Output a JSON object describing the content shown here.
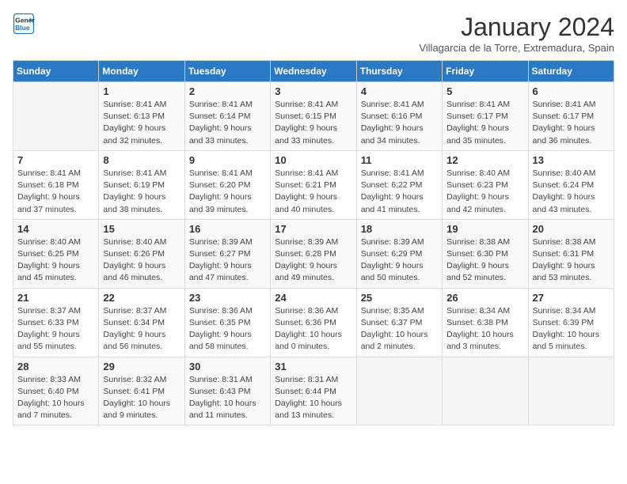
{
  "logo": {
    "line1": "General",
    "line2": "Blue"
  },
  "title": "January 2024",
  "subtitle": "Villagarcia de la Torre, Extremadura, Spain",
  "days_header": [
    "Sunday",
    "Monday",
    "Tuesday",
    "Wednesday",
    "Thursday",
    "Friday",
    "Saturday"
  ],
  "weeks": [
    [
      {
        "day": "",
        "content": ""
      },
      {
        "day": "1",
        "content": "Sunrise: 8:41 AM\nSunset: 6:13 PM\nDaylight: 9 hours\nand 32 minutes."
      },
      {
        "day": "2",
        "content": "Sunrise: 8:41 AM\nSunset: 6:14 PM\nDaylight: 9 hours\nand 33 minutes."
      },
      {
        "day": "3",
        "content": "Sunrise: 8:41 AM\nSunset: 6:15 PM\nDaylight: 9 hours\nand 33 minutes."
      },
      {
        "day": "4",
        "content": "Sunrise: 8:41 AM\nSunset: 6:16 PM\nDaylight: 9 hours\nand 34 minutes."
      },
      {
        "day": "5",
        "content": "Sunrise: 8:41 AM\nSunset: 6:17 PM\nDaylight: 9 hours\nand 35 minutes."
      },
      {
        "day": "6",
        "content": "Sunrise: 8:41 AM\nSunset: 6:17 PM\nDaylight: 9 hours\nand 36 minutes."
      }
    ],
    [
      {
        "day": "7",
        "content": "Sunrise: 8:41 AM\nSunset: 6:18 PM\nDaylight: 9 hours\nand 37 minutes."
      },
      {
        "day": "8",
        "content": "Sunrise: 8:41 AM\nSunset: 6:19 PM\nDaylight: 9 hours\nand 38 minutes."
      },
      {
        "day": "9",
        "content": "Sunrise: 8:41 AM\nSunset: 6:20 PM\nDaylight: 9 hours\nand 39 minutes."
      },
      {
        "day": "10",
        "content": "Sunrise: 8:41 AM\nSunset: 6:21 PM\nDaylight: 9 hours\nand 40 minutes."
      },
      {
        "day": "11",
        "content": "Sunrise: 8:41 AM\nSunset: 6:22 PM\nDaylight: 9 hours\nand 41 minutes."
      },
      {
        "day": "12",
        "content": "Sunrise: 8:40 AM\nSunset: 6:23 PM\nDaylight: 9 hours\nand 42 minutes."
      },
      {
        "day": "13",
        "content": "Sunrise: 8:40 AM\nSunset: 6:24 PM\nDaylight: 9 hours\nand 43 minutes."
      }
    ],
    [
      {
        "day": "14",
        "content": "Sunrise: 8:40 AM\nSunset: 6:25 PM\nDaylight: 9 hours\nand 45 minutes."
      },
      {
        "day": "15",
        "content": "Sunrise: 8:40 AM\nSunset: 6:26 PM\nDaylight: 9 hours\nand 46 minutes."
      },
      {
        "day": "16",
        "content": "Sunrise: 8:39 AM\nSunset: 6:27 PM\nDaylight: 9 hours\nand 47 minutes."
      },
      {
        "day": "17",
        "content": "Sunrise: 8:39 AM\nSunset: 6:28 PM\nDaylight: 9 hours\nand 49 minutes."
      },
      {
        "day": "18",
        "content": "Sunrise: 8:39 AM\nSunset: 6:29 PM\nDaylight: 9 hours\nand 50 minutes."
      },
      {
        "day": "19",
        "content": "Sunrise: 8:38 AM\nSunset: 6:30 PM\nDaylight: 9 hours\nand 52 minutes."
      },
      {
        "day": "20",
        "content": "Sunrise: 8:38 AM\nSunset: 6:31 PM\nDaylight: 9 hours\nand 53 minutes."
      }
    ],
    [
      {
        "day": "21",
        "content": "Sunrise: 8:37 AM\nSunset: 6:33 PM\nDaylight: 9 hours\nand 55 minutes."
      },
      {
        "day": "22",
        "content": "Sunrise: 8:37 AM\nSunset: 6:34 PM\nDaylight: 9 hours\nand 56 minutes."
      },
      {
        "day": "23",
        "content": "Sunrise: 8:36 AM\nSunset: 6:35 PM\nDaylight: 9 hours\nand 58 minutes."
      },
      {
        "day": "24",
        "content": "Sunrise: 8:36 AM\nSunset: 6:36 PM\nDaylight: 10 hours\nand 0 minutes."
      },
      {
        "day": "25",
        "content": "Sunrise: 8:35 AM\nSunset: 6:37 PM\nDaylight: 10 hours\nand 2 minutes."
      },
      {
        "day": "26",
        "content": "Sunrise: 8:34 AM\nSunset: 6:38 PM\nDaylight: 10 hours\nand 3 minutes."
      },
      {
        "day": "27",
        "content": "Sunrise: 8:34 AM\nSunset: 6:39 PM\nDaylight: 10 hours\nand 5 minutes."
      }
    ],
    [
      {
        "day": "28",
        "content": "Sunrise: 8:33 AM\nSunset: 6:40 PM\nDaylight: 10 hours\nand 7 minutes."
      },
      {
        "day": "29",
        "content": "Sunrise: 8:32 AM\nSunset: 6:41 PM\nDaylight: 10 hours\nand 9 minutes."
      },
      {
        "day": "30",
        "content": "Sunrise: 8:31 AM\nSunset: 6:43 PM\nDaylight: 10 hours\nand 11 minutes."
      },
      {
        "day": "31",
        "content": "Sunrise: 8:31 AM\nSunset: 6:44 PM\nDaylight: 10 hours\nand 13 minutes."
      },
      {
        "day": "",
        "content": ""
      },
      {
        "day": "",
        "content": ""
      },
      {
        "day": "",
        "content": ""
      }
    ]
  ]
}
